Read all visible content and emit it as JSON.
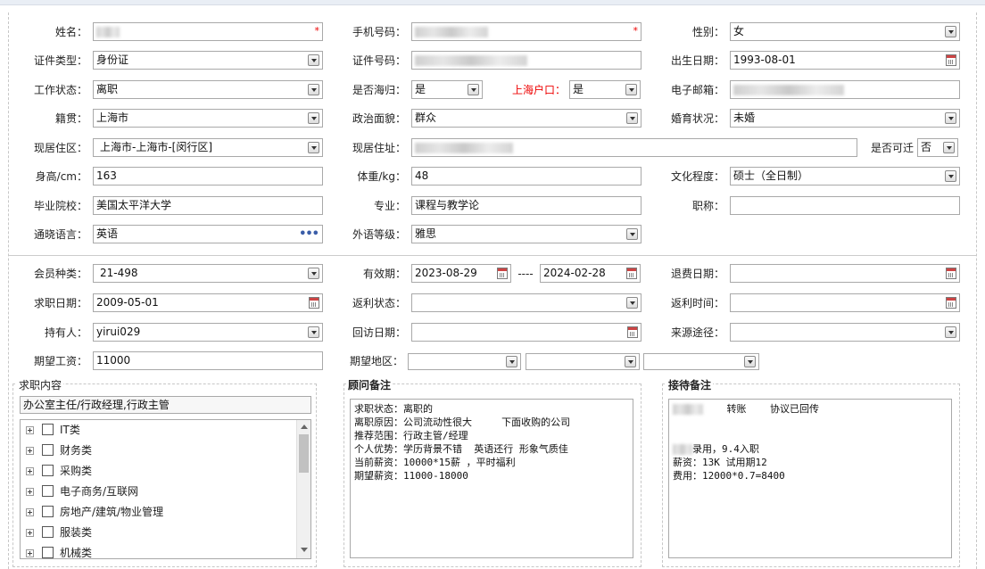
{
  "colors": {
    "required": "#e00000",
    "accent_label": "#e00000",
    "calendar_icon": "#c44444",
    "tree_dots_icon": "#3a5da8"
  },
  "row1": {
    "name_label": "姓名：",
    "phone_label": "手机号码：",
    "gender_label": "性别：",
    "gender_value": "女"
  },
  "row2": {
    "idtype_label": "证件类型：",
    "idtype_value": "身份证",
    "idno_label": "证件号码：",
    "birth_label": "出生日期：",
    "birth_value": "1993-08-01"
  },
  "row3": {
    "work_label": "工作状态：",
    "work_value": "离职",
    "haigui_label": "是否海归：",
    "haigui_value": "是",
    "hukou_label": "上海户口：",
    "hukou_value": "是",
    "email_label": "电子邮箱："
  },
  "row4": {
    "origin_label": "籍贯：",
    "origin_value": "上海市",
    "political_label": "政治面貌：",
    "political_value": "群众",
    "marital_label": "婚育状况：",
    "marital_value": "未婚"
  },
  "row5": {
    "area_label": "现居住区：",
    "area_value": "上海市-上海市-[闵行区]",
    "address_label": "现居住址：",
    "move_label": "是否可迁",
    "move_value": "否"
  },
  "row6": {
    "height_label": "身高/cm：",
    "height_value": "163",
    "weight_label": "体重/kg：",
    "weight_value": "48",
    "edu_label": "文化程度：",
    "edu_value": "硕士（全日制）"
  },
  "row7": {
    "school_label": "毕业院校：",
    "school_value": "美国太平洋大学",
    "major_label": "专业：",
    "major_value": "课程与教学论",
    "title_label": "职称：",
    "title_value": ""
  },
  "row8": {
    "lang_label": "通晓语言：",
    "lang_value": "英语",
    "level_label": "外语等级：",
    "level_value": "雅思"
  },
  "row9": {
    "member_label": "会员种类：",
    "member_value": "21-498",
    "valid_label": "有效期：",
    "valid_from": "2023-08-29",
    "valid_sep": "----",
    "valid_to": "2024-02-28",
    "refund_label": "退费日期：",
    "refund_value": ""
  },
  "row10": {
    "jobdate_label": "求职日期：",
    "jobdate_value": "2009-05-01",
    "rebate_label": "返利状态：",
    "rebate_value": "",
    "rebatetime_label": "返利时间：",
    "rebatetime_value": ""
  },
  "row11": {
    "holder_label": "持有人：",
    "holder_value": "yirui029",
    "visit_label": "回访日期：",
    "visit_value": "",
    "source_label": "来源途径：",
    "source_value": ""
  },
  "row12": {
    "salary_label": "期望工资：",
    "salary_value": "11000",
    "region_label": "期望地区：",
    "region_1": "",
    "region_2": "",
    "region_3": ""
  },
  "panel_job": {
    "title": "求职内容",
    "summary": "办公室主任/行政经理,行政主管",
    "tree": [
      "IT类",
      "财务类",
      "采购类",
      "电子商务/互联网",
      "房地产/建筑/物业管理",
      "服装类",
      "机械类"
    ]
  },
  "panel_consultant": {
    "title": "顾问备注",
    "text": "求职状态：离职的\n离职原因：公司流动性很大     下面收购的公司\n推荐范围：行政主管/经理\n个人优势：学历背景不错  英语还行 形象气质佳\n当前薪资：10000*15薪 ，平时福利\n期望薪资：11000-18000"
  },
  "panel_reception": {
    "title": "接待备注",
    "line1": "转账    协议已回传",
    "line2": "录用，9.4入职",
    "line3": "薪资：13K 试用期12",
    "line4": "费用：12000*0.7=8400"
  }
}
